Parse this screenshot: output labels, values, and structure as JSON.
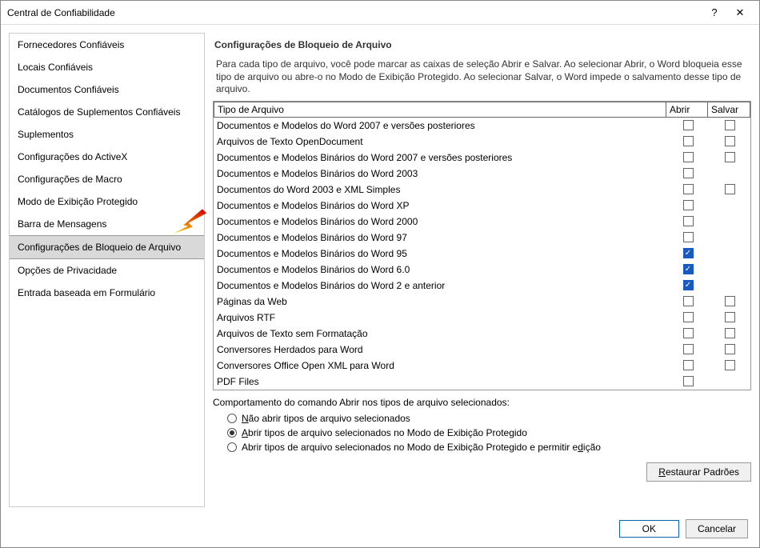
{
  "window": {
    "title": "Central de Confiabilidade",
    "help_symbol": "?",
    "close_symbol": "✕"
  },
  "sidebar": {
    "items": [
      {
        "label": "Fornecedores Confiáveis",
        "selected": false
      },
      {
        "label": "Locais Confiáveis",
        "selected": false
      },
      {
        "label": "Documentos Confiáveis",
        "selected": false
      },
      {
        "label": "Catálogos de Suplementos Confiáveis",
        "selected": false
      },
      {
        "label": "Suplementos",
        "selected": false
      },
      {
        "label": "Configurações do ActiveX",
        "selected": false
      },
      {
        "label": "Configurações de Macro",
        "selected": false
      },
      {
        "label": "Modo de Exibição Protegido",
        "selected": false
      },
      {
        "label": "Barra de Mensagens",
        "selected": false
      },
      {
        "label": "Configurações de Bloqueio de Arquivo",
        "selected": true
      },
      {
        "label": "Opções de Privacidade",
        "selected": false
      },
      {
        "label": "Entrada baseada em Formulário",
        "selected": false
      }
    ]
  },
  "main": {
    "section_title": "Configurações de Bloqueio de Arquivo",
    "intro": "Para cada tipo de arquivo, você pode marcar as caixas de seleção Abrir e Salvar. Ao selecionar Abrir, o Word bloqueia esse tipo de arquivo ou abre-o no Modo de Exibição Protegido. Ao selecionar Salvar, o Word impede o salvamento desse tipo de arquivo.",
    "table": {
      "header_type": "Tipo de Arquivo",
      "header_open": "Abrir",
      "header_save": "Salvar",
      "rows": [
        {
          "label": "Documentos e Modelos do Word 2007 e versões posteriores",
          "open": false,
          "save": false,
          "has_save": true
        },
        {
          "label": "Arquivos de Texto OpenDocument",
          "open": false,
          "save": false,
          "has_save": true
        },
        {
          "label": "Documentos e Modelos Binários do Word 2007 e versões posteriores",
          "open": false,
          "save": false,
          "has_save": true
        },
        {
          "label": "Documentos e Modelos Binários do Word 2003",
          "open": false,
          "save": null,
          "has_save": false
        },
        {
          "label": "Documentos do Word 2003 e XML Simples",
          "open": false,
          "save": false,
          "has_save": true
        },
        {
          "label": "Documentos e Modelos Binários do Word XP",
          "open": false,
          "save": null,
          "has_save": false
        },
        {
          "label": "Documentos e Modelos Binários do Word 2000",
          "open": false,
          "save": null,
          "has_save": false
        },
        {
          "label": "Documentos e Modelos Binários do Word 97",
          "open": false,
          "save": null,
          "has_save": false
        },
        {
          "label": "Documentos e Modelos Binários do Word 95",
          "open": true,
          "save": null,
          "has_save": false
        },
        {
          "label": "Documentos e Modelos Binários do Word 6.0",
          "open": true,
          "save": null,
          "has_save": false
        },
        {
          "label": "Documentos e Modelos Binários do Word 2 e anterior",
          "open": true,
          "save": null,
          "has_save": false
        },
        {
          "label": "Páginas da Web",
          "open": false,
          "save": false,
          "has_save": true
        },
        {
          "label": "Arquivos RTF",
          "open": false,
          "save": false,
          "has_save": true
        },
        {
          "label": "Arquivos de Texto sem Formatação",
          "open": false,
          "save": false,
          "has_save": true
        },
        {
          "label": "Conversores Herdados para Word",
          "open": false,
          "save": false,
          "has_save": true
        },
        {
          "label": "Conversores Office Open XML para Word",
          "open": false,
          "save": false,
          "has_save": true
        },
        {
          "label": "PDF Files",
          "open": false,
          "save": null,
          "has_save": false,
          "indent": true
        }
      ]
    },
    "behavior": {
      "label": "Comportamento do comando Abrir nos tipos de arquivo selecionados:",
      "options": [
        {
          "prefix": "N",
          "rest": "ão abrir tipos de arquivo selecionados",
          "selected": false
        },
        {
          "prefix": "A",
          "rest": "brir tipos de arquivo selecionados no Modo de Exibição Protegido",
          "selected": true
        },
        {
          "prefix": "",
          "rest_pre": "Abrir tipos de arquivo selecionados no Modo de Exibição Protegido e permitir e",
          "u": "d",
          "rest_post": "ição",
          "selected": false
        }
      ]
    },
    "restore": {
      "prefix": "R",
      "rest": "estaurar Padrões"
    }
  },
  "footer": {
    "ok": "OK",
    "cancel": "Cancelar"
  }
}
